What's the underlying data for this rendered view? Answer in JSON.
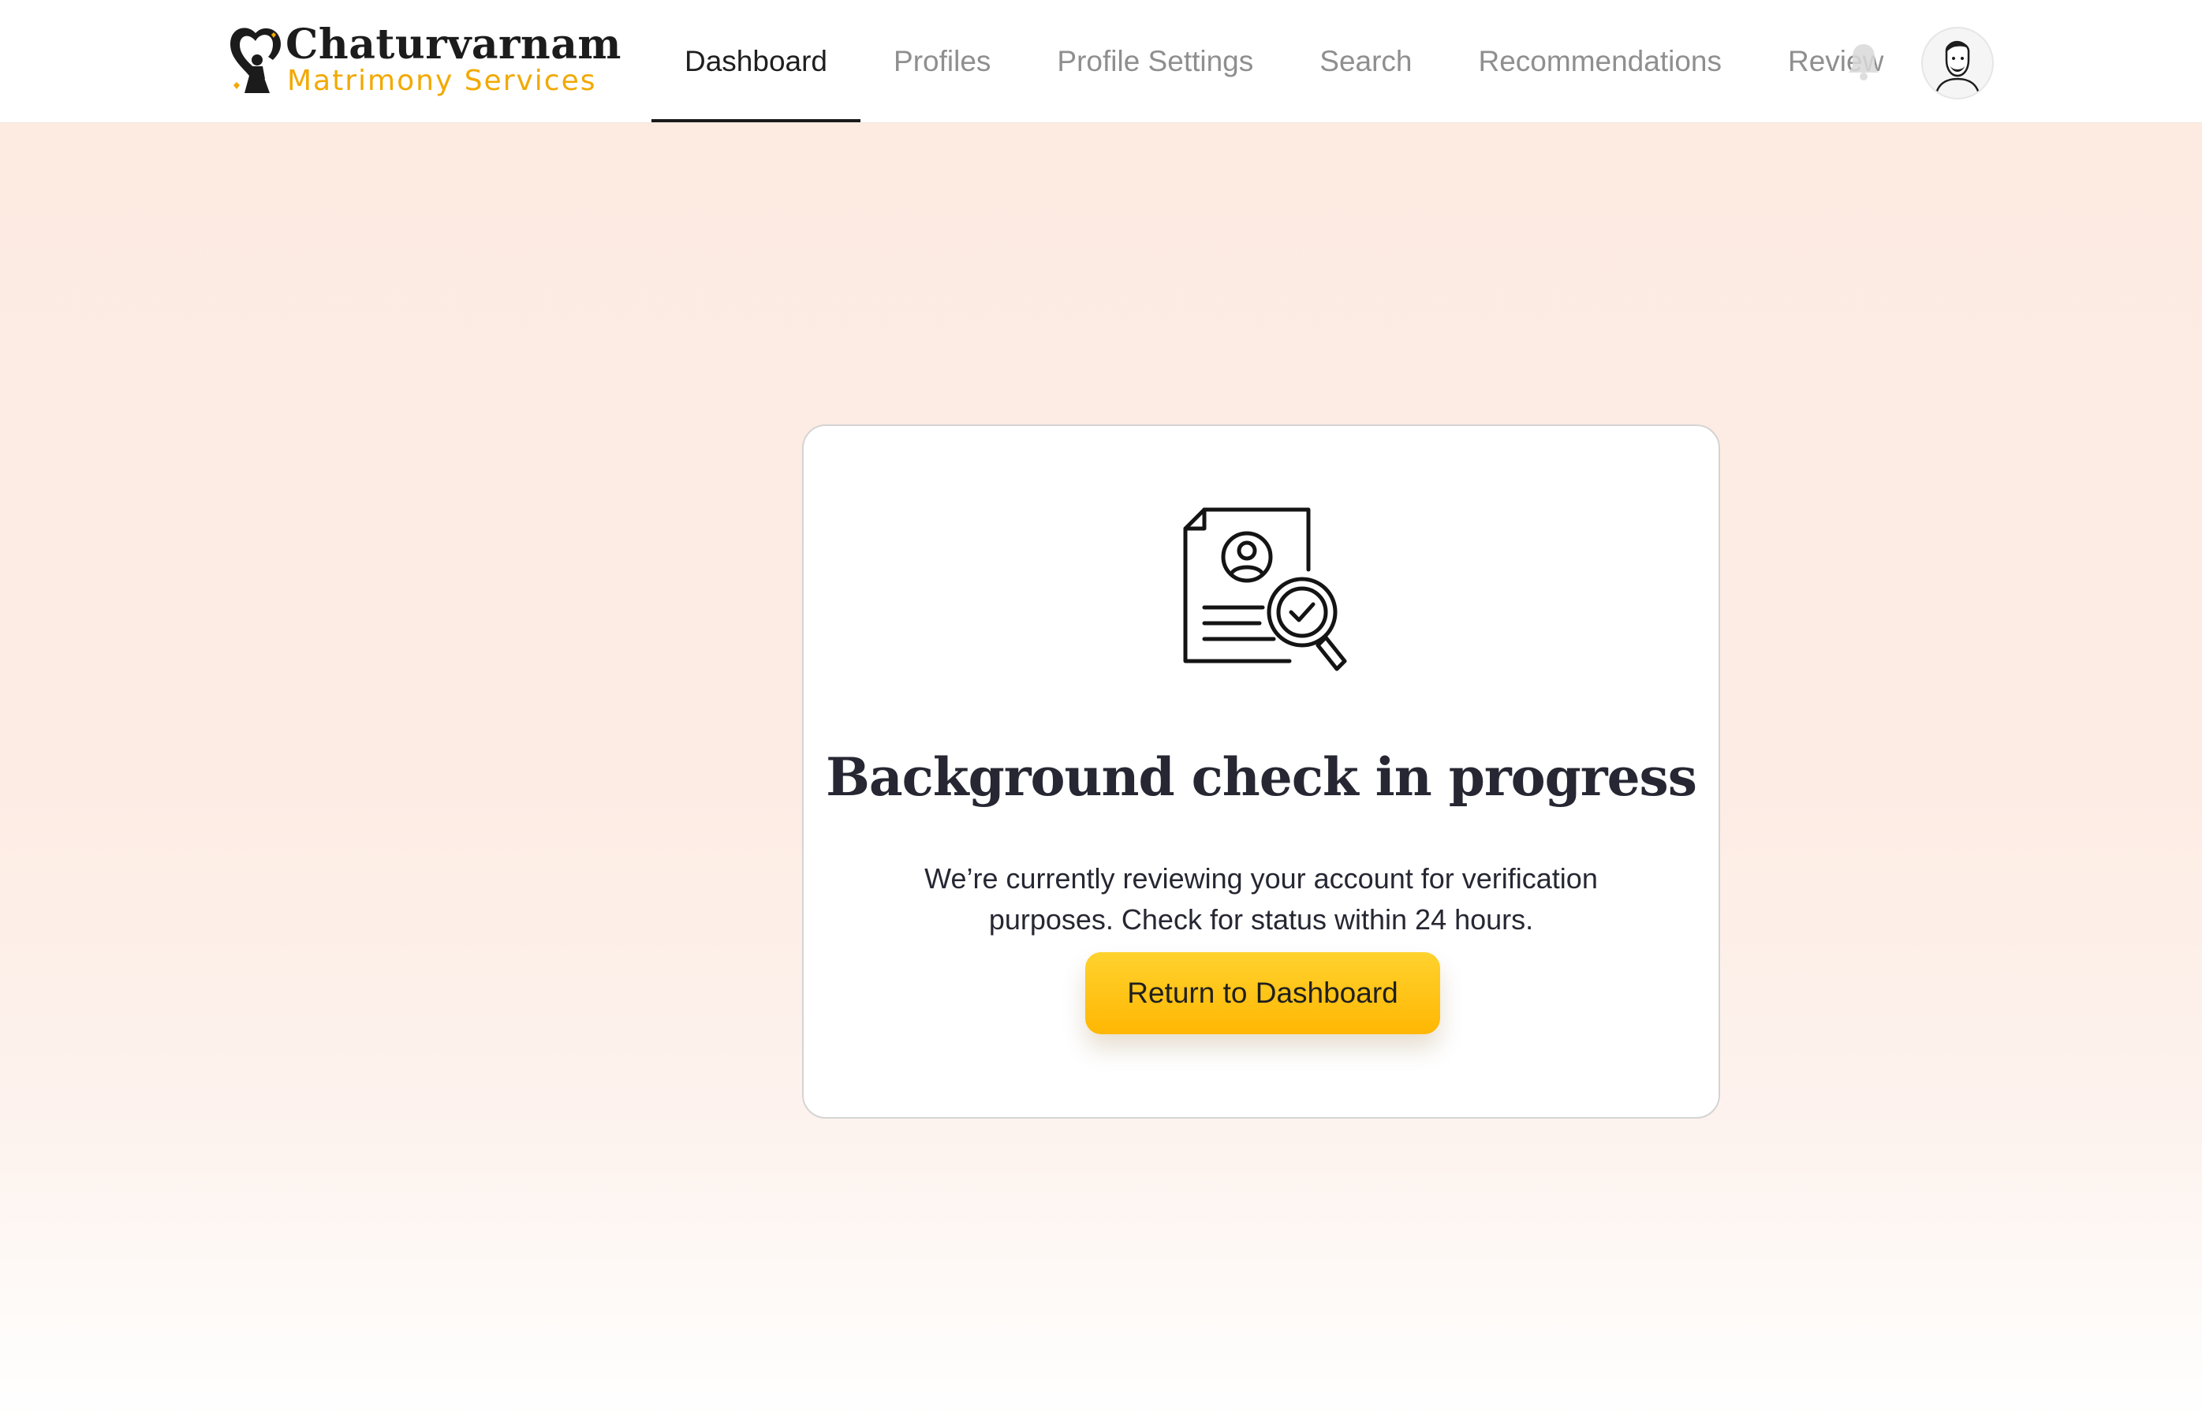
{
  "brand": {
    "name": "Chaturvarnam",
    "tagline": "Matrimony Services",
    "accent_color": "#f2a900"
  },
  "nav": {
    "items": [
      {
        "label": "Dashboard",
        "active": true
      },
      {
        "label": "Profiles",
        "active": false
      },
      {
        "label": "Profile Settings",
        "active": false
      },
      {
        "label": "Search",
        "active": false
      },
      {
        "label": "Recommendations",
        "active": false
      },
      {
        "label": "Review",
        "active": false
      }
    ]
  },
  "header_icons": {
    "notification": "bell-icon",
    "avatar": "user-avatar"
  },
  "status_card": {
    "icon": "document-search-check-icon",
    "title": "Background check in progress",
    "message": "We’re currently reviewing your account for verification purposes. Check for status within 24 hours.",
    "button_label": "Return to Dashboard",
    "button_color": "#ffc21a"
  }
}
